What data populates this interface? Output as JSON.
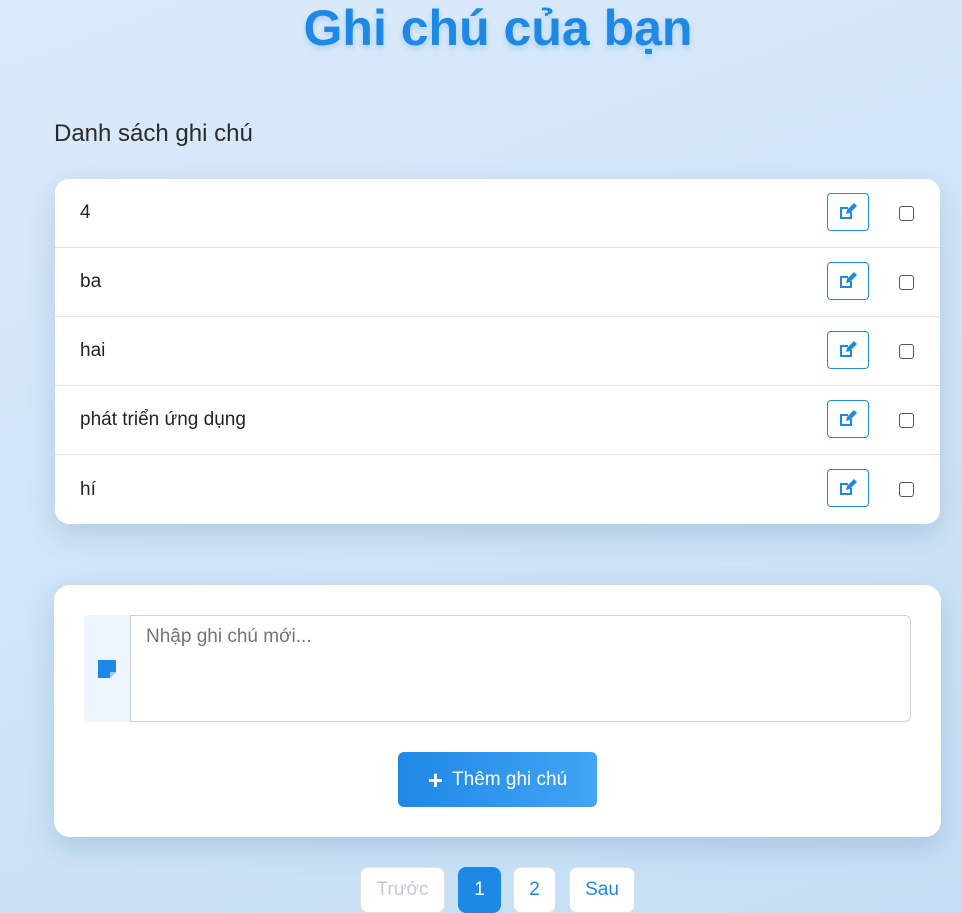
{
  "page": {
    "title": "Ghi chú của bạn"
  },
  "notes_section": {
    "heading": "Danh sách ghi chú",
    "notes": [
      {
        "text": "4",
        "checked": false
      },
      {
        "text": "ba",
        "checked": false
      },
      {
        "text": "hai",
        "checked": false
      },
      {
        "text": "phát triển ứng dụng",
        "checked": false
      },
      {
        "text": "hí",
        "checked": false
      }
    ]
  },
  "add_form": {
    "placeholder": "Nhập ghi chú mới...",
    "add_label": "Thêm ghi chú",
    "note_icon": "sticky-note-icon",
    "plus_icon": "plus-icon"
  },
  "pagination": {
    "prev_label": "Trước",
    "pages": [
      "1",
      "2"
    ],
    "current": "1",
    "next_label": "Sau"
  },
  "colors": {
    "accent": "#1e88e5",
    "accent_light": "#42a5f5"
  }
}
